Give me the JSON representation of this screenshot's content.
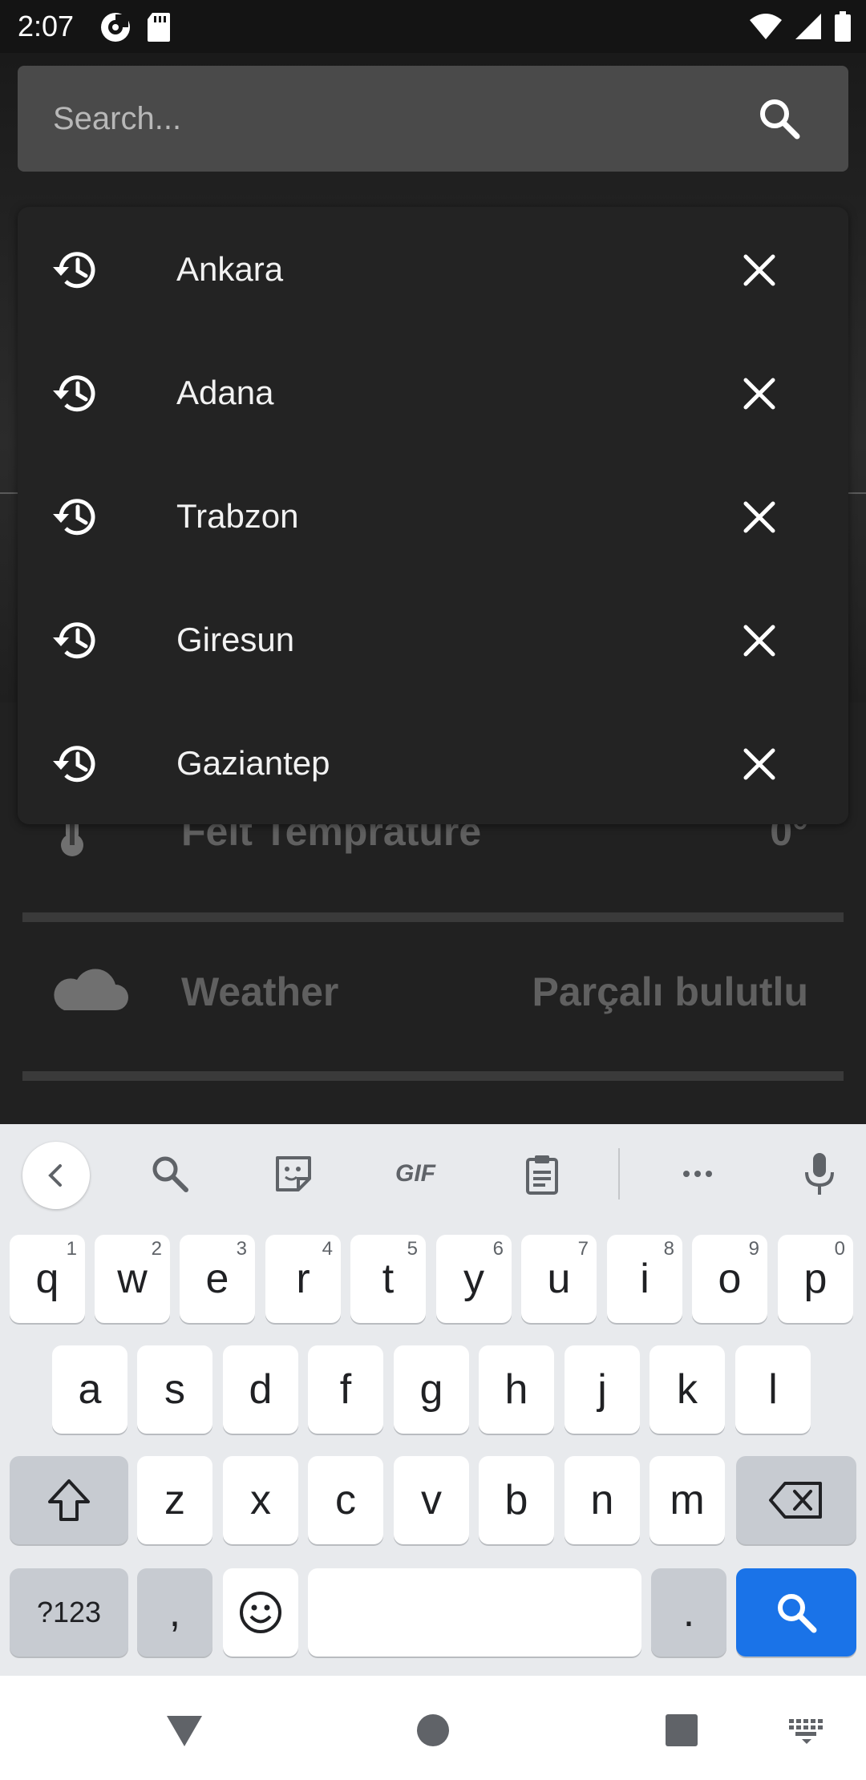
{
  "status_bar": {
    "time": "2:07",
    "left_icons": [
      "pocket-casts-icon",
      "sd-card-icon"
    ],
    "right_icons": [
      "wifi-icon",
      "cell-signal-icon",
      "battery-icon"
    ]
  },
  "search": {
    "placeholder": "Search...",
    "value": "",
    "button_icon": "search-icon"
  },
  "suggestions": [
    {
      "label": "Ankara",
      "icon": "history-icon",
      "remove_icon": "close-icon"
    },
    {
      "label": "Adana",
      "icon": "history-icon",
      "remove_icon": "close-icon"
    },
    {
      "label": "Trabzon",
      "icon": "history-icon",
      "remove_icon": "close-icon"
    },
    {
      "label": "Giresun",
      "icon": "history-icon",
      "remove_icon": "close-icon"
    },
    {
      "label": "Gaziantep",
      "icon": "history-icon",
      "remove_icon": "close-icon"
    }
  ],
  "weather_rows": [
    {
      "label": "Felt Temprature",
      "value": "0°",
      "icon": "thermometer-icon"
    },
    {
      "label": "Weather",
      "value": "Parçalı bulutlu",
      "icon": "cloud-icon"
    }
  ],
  "keyboard": {
    "toolbar": [
      "back-chevron-icon",
      "search-icon",
      "sticker-icon",
      "GIF",
      "clipboard-icon",
      "more-icon",
      "microphone-icon"
    ],
    "row1": [
      {
        "key": "q",
        "hint": "1"
      },
      {
        "key": "w",
        "hint": "2"
      },
      {
        "key": "e",
        "hint": "3"
      },
      {
        "key": "r",
        "hint": "4"
      },
      {
        "key": "t",
        "hint": "5"
      },
      {
        "key": "y",
        "hint": "6"
      },
      {
        "key": "u",
        "hint": "7"
      },
      {
        "key": "i",
        "hint": "8"
      },
      {
        "key": "o",
        "hint": "9"
      },
      {
        "key": "p",
        "hint": "0"
      }
    ],
    "row2": [
      "a",
      "s",
      "d",
      "f",
      "g",
      "h",
      "j",
      "k",
      "l"
    ],
    "row3": [
      "z",
      "x",
      "c",
      "v",
      "b",
      "n",
      "m"
    ],
    "symbols_label": "?123",
    "comma": ",",
    "period": ".",
    "accent_color": "#1a73e8"
  },
  "nav": [
    "back-icon",
    "home-icon",
    "recents-icon",
    "keyboard-switch-icon"
  ]
}
